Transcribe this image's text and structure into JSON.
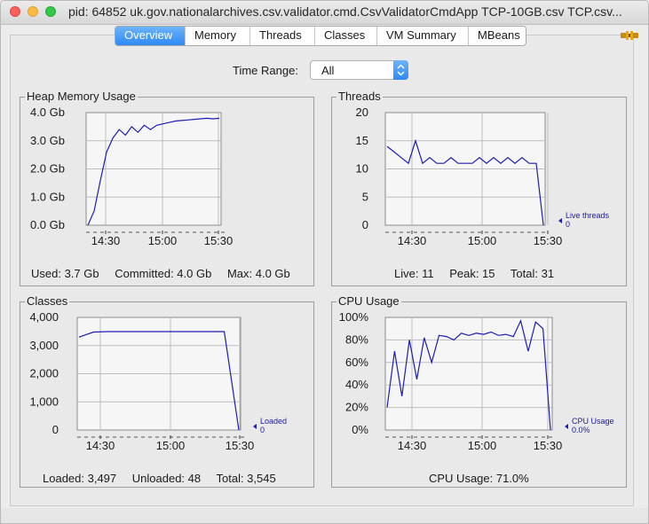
{
  "window": {
    "title": "pid: 64852 uk.gov.nationalarchives.csv.validator.cmd.CsvValidatorCmdApp TCP-10GB.csv TCP.csv..."
  },
  "tabs": [
    "Overview",
    "Memory",
    "Threads",
    "Classes",
    "VM Summary",
    "MBeans"
  ],
  "time_range": {
    "label": "Time Range:",
    "value": "All"
  },
  "colors": {
    "line": "#1d1db5",
    "plot_bg": "#f6f6f6",
    "grid": "#bdbdbd",
    "tab_active": "#2f8af5"
  },
  "panels": {
    "heap": {
      "title": "Heap Memory Usage",
      "y_ticks": [
        "4.0 Gb",
        "3.0 Gb",
        "2.0 Gb",
        "1.0 Gb",
        "0.0 Gb"
      ],
      "x_ticks": [
        "14:30",
        "15:00",
        "15:30"
      ],
      "stats": [
        "Used: 3.7 Gb",
        "Committed: 4.0 Gb",
        "Max: 4.0 Gb"
      ]
    },
    "threads": {
      "title": "Threads",
      "y_ticks": [
        "20",
        "15",
        "10",
        "5",
        "0"
      ],
      "x_ticks": [
        "14:30",
        "15:00",
        "15:30"
      ],
      "legend": [
        "Live threads",
        "0"
      ],
      "stats": [
        "Live: 11",
        "Peak: 15",
        "Total: 31"
      ]
    },
    "classes": {
      "title": "Classes",
      "y_ticks": [
        "4,000",
        "3,000",
        "2,000",
        "1,000",
        "0"
      ],
      "x_ticks": [
        "14:30",
        "15:00",
        "15:30"
      ],
      "legend": [
        "Loaded",
        "0"
      ],
      "stats": [
        "Loaded: 3,497",
        "Unloaded: 48",
        "Total: 3,545"
      ]
    },
    "cpu": {
      "title": "CPU Usage",
      "y_ticks": [
        "100%",
        "80%",
        "60%",
        "40%",
        "20%",
        "0%"
      ],
      "x_ticks": [
        "14:30",
        "15:00",
        "15:30"
      ],
      "legend": [
        "CPU Usage",
        "0.0%"
      ],
      "stats": [
        "CPU Usage: 71.0%"
      ]
    }
  },
  "chart_data": [
    {
      "type": "line",
      "title": "Heap Memory Usage",
      "ylim": [
        0,
        4
      ],
      "x_ticks": [
        "14:30",
        "15:00",
        "15:30"
      ],
      "series": [
        {
          "values": [
            0.0,
            0.5,
            1.6,
            2.6,
            3.1,
            3.4,
            3.2,
            3.5,
            3.3,
            3.55,
            3.4,
            3.55,
            3.6,
            3.65,
            3.7,
            3.72,
            3.74,
            3.76,
            3.78,
            3.8,
            3.78,
            3.8
          ]
        }
      ]
    },
    {
      "type": "line",
      "title": "Threads",
      "ylim": [
        0,
        20
      ],
      "x_ticks": [
        "14:30",
        "15:00",
        "15:30"
      ],
      "series": [
        {
          "values": [
            14,
            13,
            12,
            11,
            15,
            11,
            12,
            11,
            11,
            12,
            11,
            11,
            11,
            12,
            11,
            12,
            11,
            12,
            11,
            12,
            11,
            11,
            0
          ]
        }
      ]
    },
    {
      "type": "line",
      "title": "Classes",
      "ylim": [
        0,
        4000
      ],
      "x_ticks": [
        "14:30",
        "15:00",
        "15:30"
      ],
      "series": [
        {
          "values": [
            3300,
            3480,
            3497,
            3497,
            3497,
            3497,
            3497,
            3497,
            3497,
            3497,
            3497,
            0
          ]
        }
      ]
    },
    {
      "type": "line",
      "title": "CPU Usage",
      "ylim": [
        0,
        100
      ],
      "x_ticks": [
        "14:30",
        "15:00",
        "15:30"
      ],
      "series": [
        {
          "values": [
            20,
            70,
            30,
            80,
            45,
            82,
            60,
            84,
            83,
            80,
            86,
            84,
            86,
            85,
            87,
            84,
            85,
            83,
            97,
            70,
            96,
            90,
            0
          ]
        }
      ]
    }
  ]
}
